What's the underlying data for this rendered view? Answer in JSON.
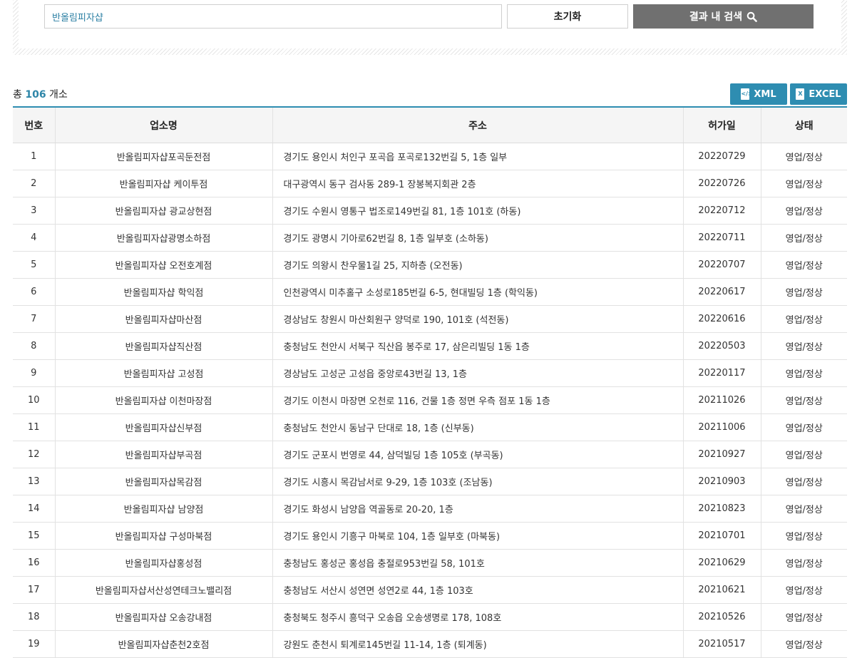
{
  "search": {
    "value": "반올림피자샵",
    "reset_label": "초기화",
    "submit_label": "결과 내 검색",
    "submit_icon": "search-icon"
  },
  "summary": {
    "prefix": "총",
    "count": "106",
    "suffix": "개소"
  },
  "downloads": {
    "xml_label": "XML",
    "xml_icon": "xml-file-icon",
    "excel_label": "EXCEL",
    "excel_icon": "excel-file-icon"
  },
  "colors": {
    "accent": "#2e8db1",
    "search_button": "#707070",
    "count_text": "#2e86a8"
  },
  "table": {
    "headers": [
      "번호",
      "업소명",
      "주소",
      "허가일",
      "상태"
    ],
    "rows": [
      [
        "1",
        "반올림피자샵포곡둔전점",
        "경기도 용인시 처인구 포곡읍 포곡로132번길 5, 1층 일부",
        "20220729",
        "영업/정상"
      ],
      [
        "2",
        "반올림피자샵 케이투점",
        "대구광역시 동구 검사동 289-1 장봉복지회관 2층",
        "20220726",
        "영업/정상"
      ],
      [
        "3",
        "반올림피자샵 광교상현점",
        "경기도 수원시 영통구 법조로149번길 81, 1층 101호 (하동)",
        "20220712",
        "영업/정상"
      ],
      [
        "4",
        "반올림피자샵광명소하점",
        "경기도 광명시 기아로62번길 8, 1층 일부호 (소하동)",
        "20220711",
        "영업/정상"
      ],
      [
        "5",
        "반올림피자샵 오전호계점",
        "경기도 의왕시 찬우물1길 25, 지하층 (오전동)",
        "20220707",
        "영업/정상"
      ],
      [
        "6",
        "반올림피자샵 학익점",
        "인천광역시 미추홀구 소성로185번길 6-5, 현대빌딩 1층 (학익동)",
        "20220617",
        "영업/정상"
      ],
      [
        "7",
        "반올림피자샵마산점",
        "경상남도 창원시 마산회원구 양덕로 190, 101호 (석전동)",
        "20220616",
        "영업/정상"
      ],
      [
        "8",
        "반올림피자샵직산점",
        "충청남도 천안시 서북구 직산읍 봉주로 17, 삼은리빌딩 1동 1층",
        "20220503",
        "영업/정상"
      ],
      [
        "9",
        "반올림피자샵 고성점",
        "경상남도 고성군 고성읍 중앙로43번길 13, 1층",
        "20220117",
        "영업/정상"
      ],
      [
        "10",
        "반올림피자샵 이천마장점",
        "경기도 이천시 마장면 오천로 116, 건물 1층 정면 우측 점포 1동 1층",
        "20211026",
        "영업/정상"
      ],
      [
        "11",
        "반올림피자샵신부점",
        "충청남도 천안시 동남구 단대로 18, 1층 (신부동)",
        "20211006",
        "영업/정상"
      ],
      [
        "12",
        "반올림피자샵부곡점",
        "경기도 군포시 번영로 44, 삼덕빌딩 1층 105호 (부곡동)",
        "20210927",
        "영업/정상"
      ],
      [
        "13",
        "반올림피자샵목감점",
        "경기도 시흥시 목감남서로 9-29, 1층 103호 (조남동)",
        "20210903",
        "영업/정상"
      ],
      [
        "14",
        "반올림피자샵 남양점",
        "경기도 화성시 남양읍 역골동로 20-20, 1층",
        "20210823",
        "영업/정상"
      ],
      [
        "15",
        "반올림피자샵 구성마북점",
        "경기도 용인시 기흥구 마북로 104, 1층 일부호 (마북동)",
        "20210701",
        "영업/정상"
      ],
      [
        "16",
        "반올림피자샵홍성점",
        "충청남도 홍성군 홍성읍 충절로953번길 58, 101호",
        "20210629",
        "영업/정상"
      ],
      [
        "17",
        "반올림피자샵서산성연테크노밸리점",
        "충청남도 서산시 성연면 성연2로 44, 1층 103호",
        "20210621",
        "영업/정상"
      ],
      [
        "18",
        "반올림피자샵 오송강내점",
        "충청북도 청주시 흥덕구 오송읍 오송생명로 178, 108호",
        "20210526",
        "영업/정상"
      ],
      [
        "19",
        "반올림피자샵춘천2호점",
        "강원도 춘천시 퇴계로145번길 11-14, 1층 (퇴계동)",
        "20210517",
        "영업/정상"
      ]
    ]
  }
}
